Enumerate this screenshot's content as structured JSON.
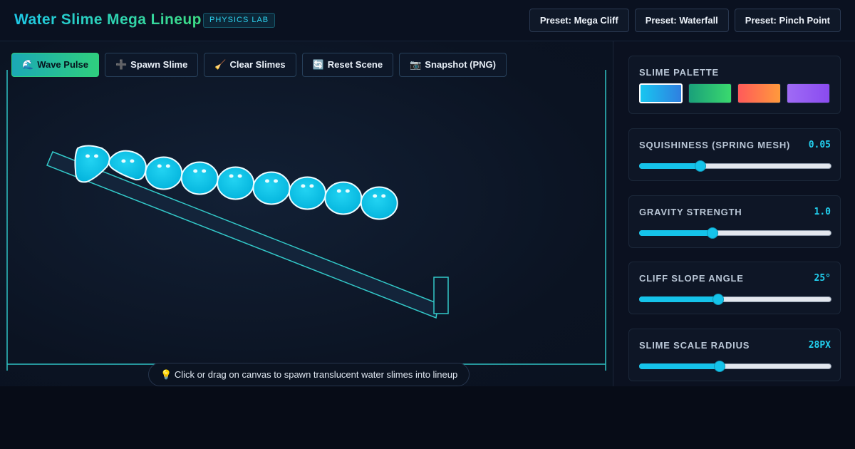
{
  "header": {
    "title": "Water Slime Mega Lineup",
    "badge": "PHYSICS LAB",
    "presets": [
      "Preset: Mega Cliff",
      "Preset: Waterfall",
      "Preset: Pinch Point"
    ]
  },
  "toolbar": {
    "buttons": [
      {
        "icon": "🌊",
        "icon_name": "wave-icon",
        "label": "Wave Pulse",
        "active": true
      },
      {
        "icon": "➕",
        "icon_name": "plus-icon",
        "label": "Spawn Slime",
        "active": false
      },
      {
        "icon": "🧹",
        "icon_name": "broom-icon",
        "label": "Clear Slimes",
        "active": false
      },
      {
        "icon": "🔄",
        "icon_name": "refresh-icon",
        "label": "Reset Scene",
        "active": false
      },
      {
        "icon": "📷",
        "icon_name": "camera-icon",
        "label": "Snapshot (PNG)",
        "active": false
      }
    ]
  },
  "scene": {
    "slime_count": 9,
    "slime_color": "#05c2e8",
    "ramp_color": "#33c9c9"
  },
  "hint": {
    "icon": "💡",
    "icon_name": "lightbulb-icon",
    "text": "Click or drag on canvas to spawn translucent water slimes into lineup"
  },
  "panel": {
    "palette": {
      "label": "Slime Palette",
      "swatches": [
        {
          "name": "cyan",
          "from": "#18c6f0",
          "to": "#2f7fe0",
          "selected": true
        },
        {
          "name": "green",
          "from": "#1aa07a",
          "to": "#3ad96e",
          "selected": false
        },
        {
          "name": "orange",
          "from": "#ff5a5a",
          "to": "#ff9a3c",
          "selected": false
        },
        {
          "name": "purple",
          "from": "#9f6bf5",
          "to": "#8a4bf0",
          "selected": false
        }
      ]
    },
    "sliders": [
      {
        "key": "squishiness",
        "label": "Squishiness (Spring Mesh)",
        "value": "0.05",
        "fraction": 0.32
      },
      {
        "key": "gravity",
        "label": "Gravity Strength",
        "value": "1.0",
        "fraction": 0.38
      },
      {
        "key": "slope",
        "label": "Cliff Slope Angle",
        "value": "25°",
        "fraction": 0.41
      },
      {
        "key": "radius",
        "label": "Slime Scale Radius",
        "value": "28px",
        "fraction": 0.42
      }
    ]
  },
  "colors": {
    "accent": "#22cfee",
    "accent_green": "#3ddc84",
    "background": "#070c17"
  }
}
